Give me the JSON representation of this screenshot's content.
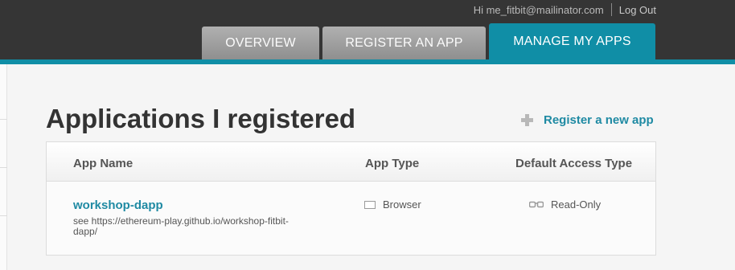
{
  "header": {
    "greeting": "Hi me_fitbit@mailinator.com",
    "logout": "Log Out",
    "tabs": [
      {
        "label": "OVERVIEW",
        "active": false
      },
      {
        "label": "REGISTER AN APP",
        "active": false
      },
      {
        "label": "MANAGE MY APPS",
        "active": true
      }
    ],
    "accent_color": "#108ea6"
  },
  "main": {
    "title": "Applications I registered",
    "register_link": "Register a new app",
    "register_icon": "plus-icon",
    "table": {
      "columns": [
        "App Name",
        "App Type",
        "Default Access Type"
      ],
      "rows": [
        {
          "name": "workshop-dapp",
          "description": "see https://ethereum-play.github.io/workshop-fitbit-dapp/",
          "type": "Browser",
          "type_icon": "browser-icon",
          "access": "Read-Only",
          "access_icon": "glasses-icon"
        }
      ]
    }
  }
}
